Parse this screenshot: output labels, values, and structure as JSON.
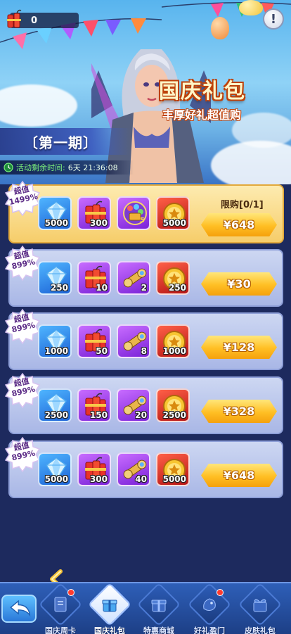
{
  "header": {
    "currency_count": "0",
    "title": "国庆礼包",
    "subtitle": "丰厚好礼超值购",
    "period": "〔第一期〕",
    "timer_label": "活动剩余时间:",
    "timer_value": "6天 21:36:08",
    "warn_symbol": "!"
  },
  "packs": [
    {
      "badge": [
        "超值",
        "1499%"
      ],
      "limit": "限购[0/1]",
      "price": "¥648",
      "items": [
        {
          "kind": "diamond",
          "qty": "5000"
        },
        {
          "kind": "firecracker",
          "qty": "300"
        },
        {
          "kind": "special-chest",
          "qty": ""
        },
        {
          "kind": "gold-medal",
          "qty": "5000"
        }
      ]
    },
    {
      "badge": [
        "超值",
        "899%"
      ],
      "price": "¥30",
      "items": [
        {
          "kind": "diamond",
          "qty": "250"
        },
        {
          "kind": "firecracker",
          "qty": "10"
        },
        {
          "kind": "scroll",
          "qty": "2"
        },
        {
          "kind": "gold-medal",
          "qty": "250"
        }
      ]
    },
    {
      "badge": [
        "超值",
        "899%"
      ],
      "price": "¥128",
      "items": [
        {
          "kind": "diamond",
          "qty": "1000"
        },
        {
          "kind": "firecracker",
          "qty": "50"
        },
        {
          "kind": "scroll",
          "qty": "8"
        },
        {
          "kind": "gold-medal",
          "qty": "1000"
        }
      ]
    },
    {
      "badge": [
        "超值",
        "899%"
      ],
      "price": "¥328",
      "items": [
        {
          "kind": "diamond",
          "qty": "2500"
        },
        {
          "kind": "firecracker",
          "qty": "150"
        },
        {
          "kind": "scroll",
          "qty": "20"
        },
        {
          "kind": "gold-medal",
          "qty": "2500"
        }
      ]
    },
    {
      "badge": [
        "超值",
        "899%"
      ],
      "price": "¥648",
      "items": [
        {
          "kind": "diamond",
          "qty": "5000"
        },
        {
          "kind": "firecracker",
          "qty": "300"
        },
        {
          "kind": "scroll",
          "qty": "40"
        },
        {
          "kind": "gold-medal",
          "qty": "5000"
        }
      ]
    }
  ],
  "nav": {
    "tabs": [
      {
        "label": "国庆周卡",
        "icon": "card-icon",
        "dot": true
      },
      {
        "label": "国庆礼包",
        "icon": "gift-box-icon",
        "active": true
      },
      {
        "label": "特惠商城",
        "icon": "shop-gift-icon"
      },
      {
        "label": "好礼盈门",
        "icon": "dragon-icon",
        "dot": true
      },
      {
        "label": "皮肤礼包",
        "icon": "skin-gift-icon"
      }
    ]
  }
}
